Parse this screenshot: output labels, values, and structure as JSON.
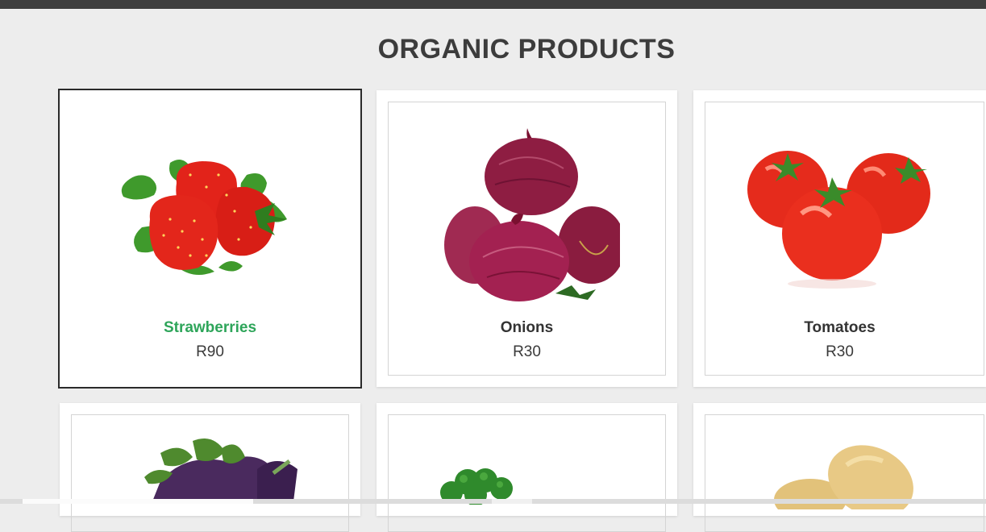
{
  "page": {
    "title": "ORGANIC PRODUCTS"
  },
  "products": [
    {
      "name": "Strawberries",
      "price": "R90",
      "image": "strawberries-image",
      "selected": true
    },
    {
      "name": "Onions",
      "price": "R30",
      "image": "onions-image",
      "selected": false
    },
    {
      "name": "Tomatoes",
      "price": "R30",
      "image": "tomatoes-image",
      "selected": false
    },
    {
      "name": "",
      "price": "",
      "image": "eggplants-image",
      "selected": false
    },
    {
      "name": "",
      "price": "",
      "image": "broccoli-image",
      "selected": false
    },
    {
      "name": "",
      "price": "",
      "image": "potatoes-image",
      "selected": false
    }
  ],
  "colors": {
    "topbar": "#3e3e3e",
    "background": "#ededed",
    "selected_name": "#2ea55a",
    "title": "#3c3c3c"
  }
}
